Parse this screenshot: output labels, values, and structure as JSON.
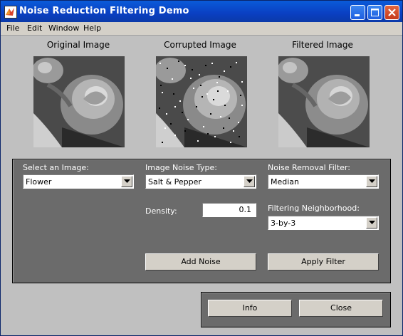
{
  "window": {
    "title": "Noise Reduction Filtering Demo"
  },
  "menu": [
    "File",
    "Edit",
    "Window",
    "Help"
  ],
  "images": {
    "original_label": "Original Image",
    "corrupted_label": "Corrupted Image",
    "filtered_label": "Filtered Image"
  },
  "controls": {
    "image_label": "Select an Image:",
    "image_value": "Flower",
    "noise_label": "Image Noise Type:",
    "noise_value": "Salt & Pepper",
    "filter_label": "Noise Removal Filter:",
    "filter_value": "Median",
    "density_label": "Density:",
    "density_value": "0.1",
    "neighborhood_label": "Filtering Neighborhood:",
    "neighborhood_value": "3-by-3",
    "add_noise_label": "Add Noise",
    "apply_filter_label": "Apply Filter"
  },
  "footer": {
    "info_label": "Info",
    "close_label": "Close"
  },
  "colors": {
    "titlebar": "#0a3fc2",
    "panel": "#6b6b6b",
    "client": "#c0c0c0"
  },
  "icons": [
    "matlab-logo-icon",
    "minimize-icon",
    "maximize-icon",
    "close-icon",
    "dropdown-arrow-icon"
  ]
}
